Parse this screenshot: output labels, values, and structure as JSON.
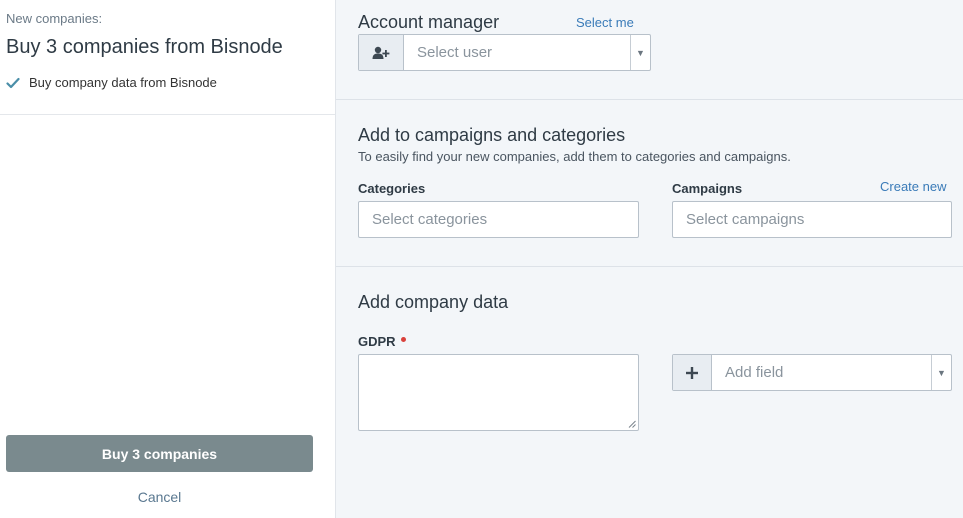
{
  "left": {
    "subtitle": "New companies:",
    "title": "Buy 3 companies from Bisnode",
    "check_item": "Buy company data from Bisnode",
    "buy_button": "Buy 3 companies",
    "cancel": "Cancel"
  },
  "account_manager": {
    "heading": "Account manager",
    "select_me": "Select me",
    "select_user_placeholder": "Select user",
    "icon": "add-user-icon"
  },
  "campaigns": {
    "heading": "Add to campaigns and categories",
    "description": "To easily find your new companies, add them to categories and campaigns.",
    "categories_label": "Categories",
    "categories_placeholder": "Select categories",
    "campaigns_label": "Campaigns",
    "create_new": "Create new",
    "campaigns_placeholder": "Select campaigns"
  },
  "company_data": {
    "heading": "Add company data",
    "gdpr_label": "GDPR",
    "add_field_placeholder": "Add field",
    "icon": "plus-icon"
  },
  "colors": {
    "accent_link": "#3a7bb8",
    "buy_button_bg": "#7a8a8e",
    "check": "#4a8ea8",
    "required": "#d9413b"
  }
}
